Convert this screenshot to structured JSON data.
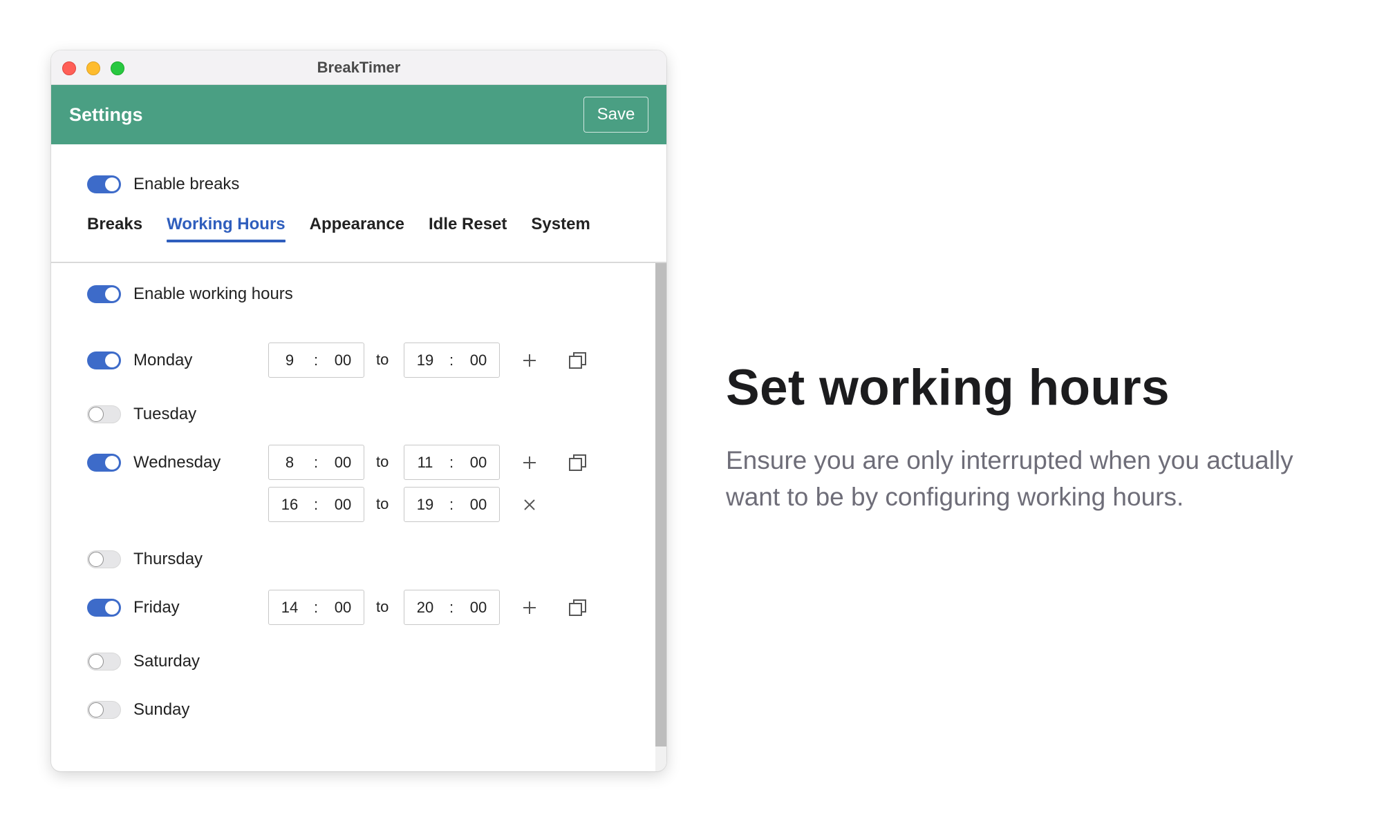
{
  "window": {
    "title": "BreakTimer"
  },
  "appbar": {
    "title": "Settings",
    "save_label": "Save"
  },
  "enable_breaks": {
    "label": "Enable breaks",
    "on": true
  },
  "tabs": [
    {
      "label": "Breaks",
      "active": false
    },
    {
      "label": "Working Hours",
      "active": true
    },
    {
      "label": "Appearance",
      "active": false
    },
    {
      "label": "Idle Reset",
      "active": false
    },
    {
      "label": "System",
      "active": false
    }
  ],
  "working_hours": {
    "enable_label": "Enable working hours",
    "enabled": true,
    "range_separator": "to",
    "time_separator": ":",
    "days": [
      {
        "name": "Monday",
        "enabled": true,
        "ranges": [
          {
            "from_h": "9",
            "from_m": "00",
            "to_h": "19",
            "to_m": "00"
          }
        ]
      },
      {
        "name": "Tuesday",
        "enabled": false,
        "ranges": []
      },
      {
        "name": "Wednesday",
        "enabled": true,
        "ranges": [
          {
            "from_h": "8",
            "from_m": "00",
            "to_h": "11",
            "to_m": "00"
          },
          {
            "from_h": "16",
            "from_m": "00",
            "to_h": "19",
            "to_m": "00"
          }
        ]
      },
      {
        "name": "Thursday",
        "enabled": false,
        "ranges": []
      },
      {
        "name": "Friday",
        "enabled": true,
        "ranges": [
          {
            "from_h": "14",
            "from_m": "00",
            "to_h": "20",
            "to_m": "00"
          }
        ]
      },
      {
        "name": "Saturday",
        "enabled": false,
        "ranges": []
      },
      {
        "name": "Sunday",
        "enabled": false,
        "ranges": []
      }
    ]
  },
  "hero": {
    "title": "Set working hours",
    "description": "Ensure you are only interrupted when you actually want to be by configuring working hours."
  },
  "colors": {
    "appbar": "#4a9f83",
    "accent": "#3d6bc9",
    "active_tab": "#2f5ebd"
  }
}
